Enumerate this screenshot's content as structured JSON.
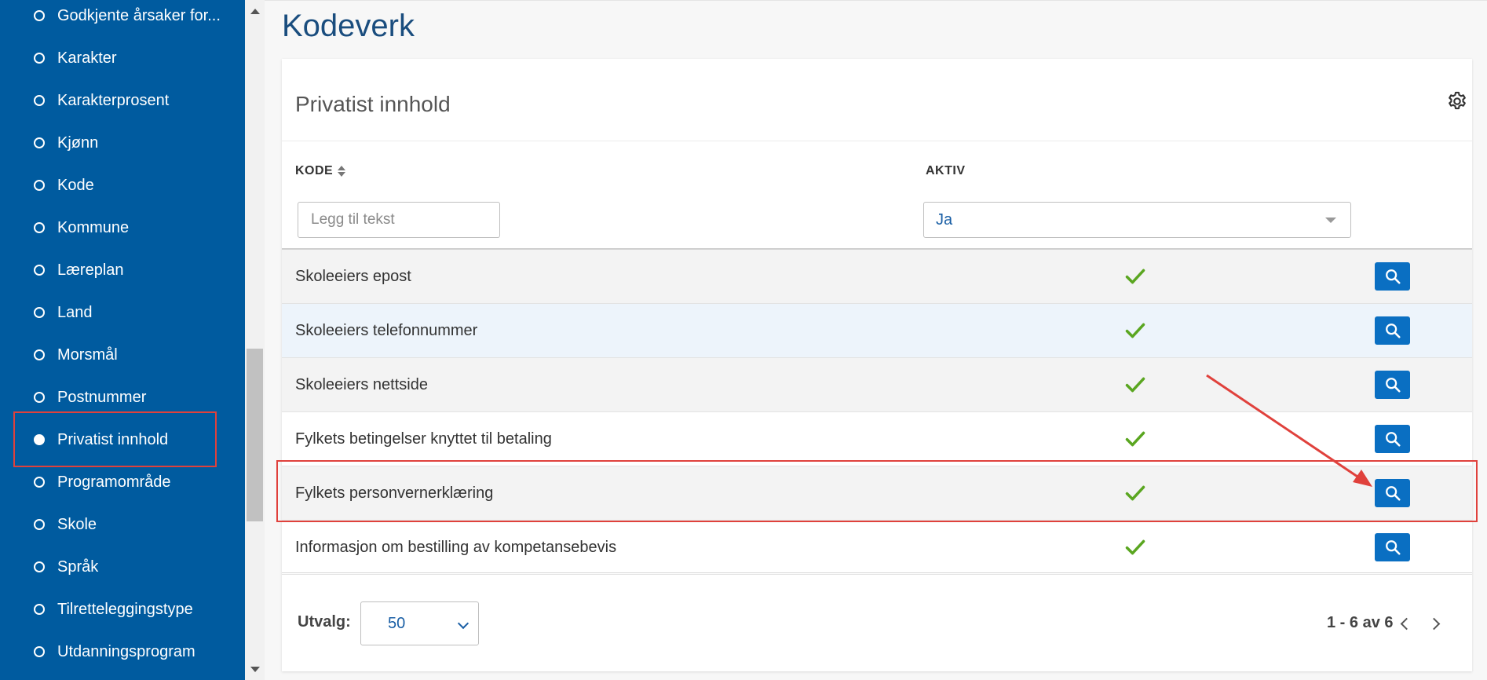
{
  "sidebar": {
    "items": [
      {
        "label": "Godkjente årsaker for...",
        "active": false
      },
      {
        "label": "Karakter",
        "active": false
      },
      {
        "label": "Karakterprosent",
        "active": false
      },
      {
        "label": "Kjønn",
        "active": false
      },
      {
        "label": "Kode",
        "active": false
      },
      {
        "label": "Kommune",
        "active": false
      },
      {
        "label": "Læreplan",
        "active": false
      },
      {
        "label": "Land",
        "active": false
      },
      {
        "label": "Morsmål",
        "active": false
      },
      {
        "label": "Postnummer",
        "active": false
      },
      {
        "label": "Privatist innhold",
        "active": true
      },
      {
        "label": "Programområde",
        "active": false
      },
      {
        "label": "Skole",
        "active": false
      },
      {
        "label": "Språk",
        "active": false
      },
      {
        "label": "Tilretteleggingstype",
        "active": false
      },
      {
        "label": "Utdanningsprogram",
        "active": false
      }
    ]
  },
  "page": {
    "title": "Kodeverk"
  },
  "card": {
    "title": "Privatist innhold"
  },
  "table": {
    "columns": {
      "kode": "KODE",
      "aktiv": "AKTIV"
    },
    "filter": {
      "kode_placeholder": "Legg til tekst",
      "aktiv_value": "Ja"
    },
    "rows": [
      {
        "kode": "Skoleeiers epost",
        "aktiv": true
      },
      {
        "kode": "Skoleeiers telefonnummer",
        "aktiv": true
      },
      {
        "kode": "Skoleeiers nettside",
        "aktiv": true
      },
      {
        "kode": "Fylkets betingelser knyttet til betaling",
        "aktiv": true
      },
      {
        "kode": "Fylkets personvernerklæring",
        "aktiv": true
      },
      {
        "kode": "Informasjon om bestilling av kompetansebevis",
        "aktiv": true
      }
    ]
  },
  "footer": {
    "utvalg_label": "Utvalg:",
    "utvalg_value": "50",
    "pager": "1 - 6 av 6"
  },
  "colors": {
    "sidebar_bg": "#005b9f",
    "accent": "#0a6fc2",
    "check": "#5aa620",
    "annotation": "#e0413c"
  },
  "icons": {
    "settings": "gear-icon",
    "view": "search-icon",
    "active": "checkmark-icon"
  }
}
